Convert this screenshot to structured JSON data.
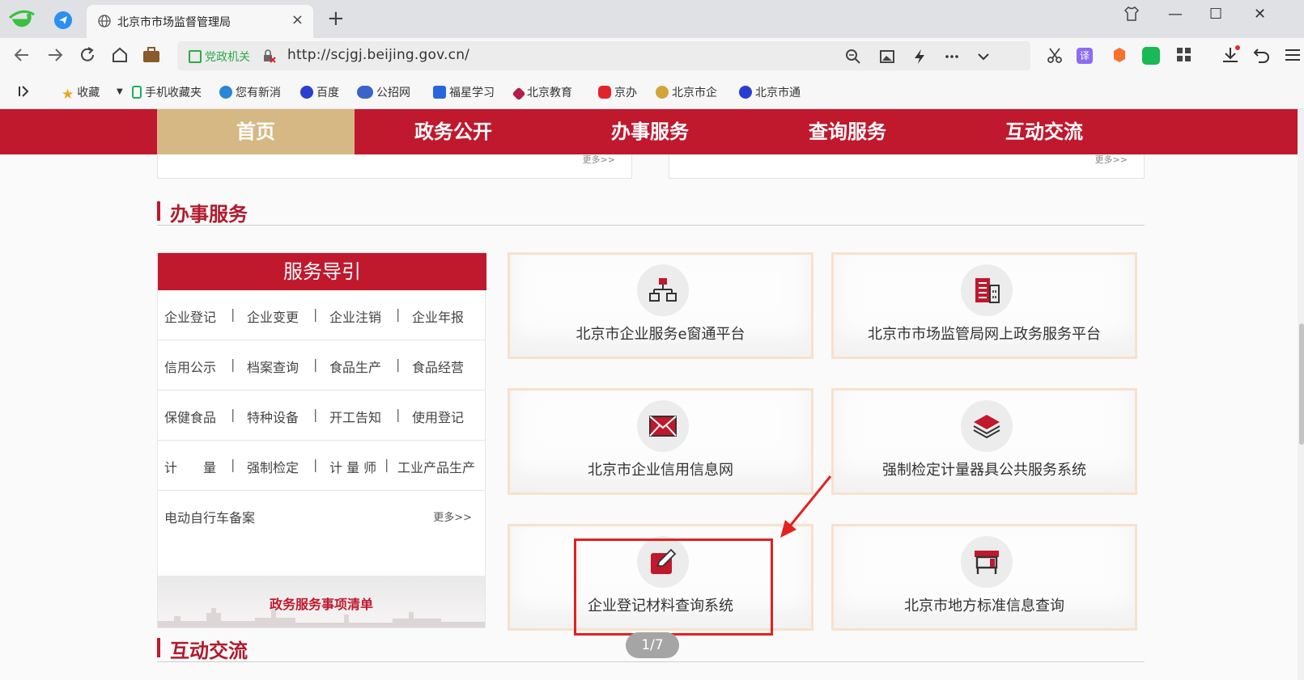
{
  "browser": {
    "tab_title": "北京市市场监督管理局",
    "tab_close": "×",
    "new_tab": "+",
    "gov_badge": "党政机关",
    "url": "http://scjgj.beijing.gov.cn/",
    "win_minimize": "—",
    "win_maximize": "☐",
    "win_close": "✕"
  },
  "bookmarks": [
    "收藏",
    "手机收藏夹",
    "您有新消",
    "百度",
    "公招网",
    "福星学习",
    "北京教育",
    "京办",
    "北京市企",
    "北京市通"
  ],
  "nav": {
    "items": [
      "首页",
      "政务公开",
      "办事服务",
      "查询服务",
      "互动交流"
    ]
  },
  "prev_cards": {
    "more_left": "更多>>",
    "more_right": "更多>>"
  },
  "section_service": {
    "title": "办事服务"
  },
  "section_interact": {
    "title": "互动交流"
  },
  "guide": {
    "title": "服务导引",
    "rows": [
      [
        "企业登记",
        "企业变更",
        "企业注销",
        "企业年报"
      ],
      [
        "信用公示",
        "档案查询",
        "食品生产",
        "食品经营"
      ],
      [
        "保健食品",
        "特种设备",
        "开工告知",
        "使用登记"
      ],
      [
        "计　　量",
        "强制检定",
        "计 量 师",
        "工业产品生产"
      ]
    ],
    "last_item": "电动自行车备案",
    "more": "更多>>",
    "footer": "政务服务事项清单"
  },
  "cards": [
    {
      "label": "北京市企业服务e窗通平台",
      "icon": "org-chart-icon"
    },
    {
      "label": "北京市市场监管局网上政务服务平台",
      "icon": "building-icon"
    },
    {
      "label": "北京市企业信用信息网",
      "icon": "envelope-icon"
    },
    {
      "label": "强制检定计量器具公共服务系统",
      "icon": "layers-icon"
    },
    {
      "label": "企业登记材料查询系统",
      "icon": "edit-icon"
    },
    {
      "label": "北京市地方标准信息查询",
      "icon": "kiosk-icon"
    }
  ],
  "pager": "1/7",
  "colors": {
    "brand_red": "#c0182d",
    "nav_active": "#d6b884",
    "highlight": "#e3211f"
  }
}
